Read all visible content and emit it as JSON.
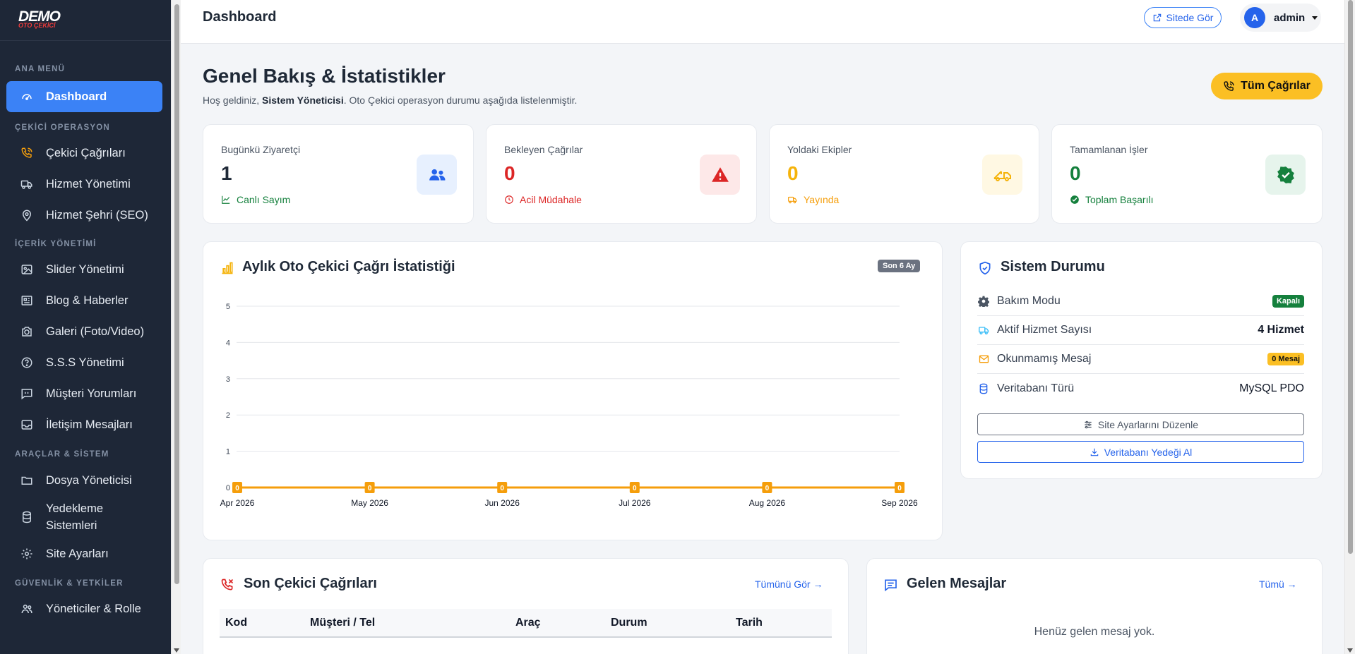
{
  "brand": {
    "logo_main": "DEMO",
    "logo_sub": "OTO ÇEKİCİ"
  },
  "sidebar": {
    "sections": [
      {
        "label": "ANA MENÜ"
      },
      {
        "label": "ÇEKİCİ OPERASYON"
      },
      {
        "label": "İÇERİK YÖNETİMİ"
      },
      {
        "label": "ARAÇLAR & SİSTEM"
      },
      {
        "label": "GÜVENLİK & YETKİLER"
      }
    ],
    "items": [
      {
        "label": "Dashboard",
        "icon": "gauge-icon"
      },
      {
        "label": "Çekici Çağrıları",
        "icon": "phone-call-icon"
      },
      {
        "label": "Hizmet Yönetimi",
        "icon": "truck-icon"
      },
      {
        "label": "Hizmet Şehri (SEO)",
        "icon": "map-pin-icon"
      },
      {
        "label": "Slider Yönetimi",
        "icon": "image-icon"
      },
      {
        "label": "Blog & Haberler",
        "icon": "newspaper-icon"
      },
      {
        "label": "Galeri (Foto/Video)",
        "icon": "camera-icon"
      },
      {
        "label": "S.S.S Yönetimi",
        "icon": "question-icon"
      },
      {
        "label": "Müşteri Yorumları",
        "icon": "comment-quote-icon"
      },
      {
        "label": "İletişim Mesajları",
        "icon": "inbox-icon"
      },
      {
        "label": "Dosya Yöneticisi",
        "icon": "folder-icon"
      },
      {
        "label": "Yedekleme Sistemleri",
        "icon": "database-icon"
      },
      {
        "label": "Site Ayarları",
        "icon": "gear-icon"
      },
      {
        "label": "Yöneticiler & Rolle",
        "icon": "users-icon"
      }
    ]
  },
  "topbar": {
    "title": "Dashboard",
    "site_button": "Sitede Gör",
    "user_initial": "A",
    "user_name": "admin"
  },
  "header": {
    "title": "Genel Bakış & İstatistikler",
    "subtitle_pre": "Hoş geldiniz, ",
    "subtitle_bold": "Sistem Yöneticisi",
    "subtitle_post": ". Oto Çekici operasyon durumu aşağıda listelenmiştir.",
    "calls_button": "Tüm Çağrılar"
  },
  "stats": [
    {
      "label": "Bugünkü Ziyaretçi",
      "value": "1",
      "footer": "Canlı Sayım",
      "color": "#1f2937",
      "foot_color": "#15803d",
      "icon": "users-icon",
      "icon_bg": "#e7f0fe",
      "icon_color": "#2563eb"
    },
    {
      "label": "Bekleyen Çağrılar",
      "value": "0",
      "footer": "Acil Müdahale",
      "color": "#dc2626",
      "foot_color": "#dc2626",
      "icon": "warning-icon",
      "icon_bg": "#fde8e8",
      "icon_color": "#dc2626"
    },
    {
      "label": "Yoldaki Ekipler",
      "value": "0",
      "footer": "Yayında",
      "color": "#f5b30b",
      "foot_color": "#f59e0b",
      "icon": "tow-truck-icon",
      "icon_bg": "#fff8e3",
      "icon_color": "#f5b30b"
    },
    {
      "label": "Tamamlanan İşler",
      "value": "0",
      "footer": "Toplam Başarılı",
      "color": "#15803d",
      "foot_color": "#15803d",
      "icon": "badge-check-icon",
      "icon_bg": "#e6f4ec",
      "icon_color": "#15803d"
    }
  ],
  "chart_card": {
    "title": "Aylık Oto Çekici Çağrı İstatistiği",
    "badge": "Son 6 Ay"
  },
  "chart_data": {
    "type": "line",
    "categories": [
      "Apr 2026",
      "May 2026",
      "Jun 2026",
      "Jul 2026",
      "Aug 2026",
      "Sep 2026"
    ],
    "values": [
      0,
      0,
      0,
      0,
      0,
      0
    ],
    "ylim": [
      0,
      5
    ],
    "yticks": [
      "0",
      "1",
      "2",
      "3",
      "4",
      "5"
    ],
    "grid": true,
    "line_color": "#f59e0b"
  },
  "system": {
    "title": "Sistem Durumu",
    "rows": [
      {
        "label": "Bakım Modu",
        "value": "Kapalı",
        "icon": "gear-icon"
      },
      {
        "label": "Aktif Hizmet Sayısı",
        "value": "4 Hizmet",
        "icon": "truck-icon"
      },
      {
        "label": "Okunmamış Mesaj",
        "value": "0 Mesaj",
        "icon": "envelope-icon"
      },
      {
        "label": "Veritabanı Türü",
        "value": "MySQL PDO",
        "icon": "database-icon"
      }
    ],
    "btn_settings": "Site Ayarlarını Düzenle",
    "btn_backup": "Veritabanı Yedeği Al"
  },
  "recent_calls": {
    "title": "Son Çekici Çağrıları",
    "link": "Tümünü Gör →",
    "columns": [
      "Kod",
      "Müşteri / Tel",
      "Araç",
      "Durum",
      "Tarih"
    ]
  },
  "messages": {
    "title": "Gelen Mesajlar",
    "link": "Tümü →",
    "empty": "Henüz gelen mesaj yok."
  }
}
